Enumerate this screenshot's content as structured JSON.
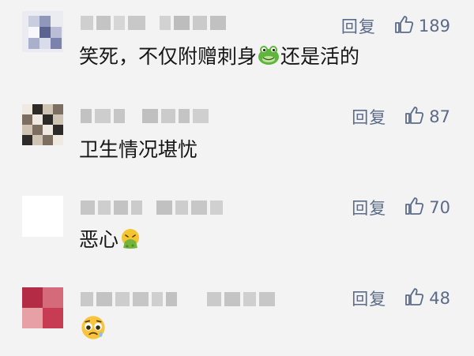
{
  "comments": [
    {
      "reply_label": "回复",
      "likes": "189",
      "text_before": "笑死，不仅附赠刺身",
      "emoji": "frog-face-emoji",
      "text_after": "还是活的",
      "avatar_colors": [
        "#d8dbe6",
        "#ffffff",
        "#9aa1bd",
        "#5b6391"
      ]
    },
    {
      "reply_label": "回复",
      "likes": "87",
      "text_before": "卫生情况堪忧",
      "emoji": "",
      "text_after": "",
      "avatar_colors": [
        "#2d2a27",
        "#cfc3b4",
        "#7d6e62",
        "#efe9e2"
      ]
    },
    {
      "reply_label": "回复",
      "likes": "70",
      "text_before": "恶心",
      "emoji": "vomiting-face-emoji",
      "text_after": "",
      "avatar_colors": [
        "#ffffff",
        "#ffffff",
        "#ffffff",
        "#ffffff"
      ]
    },
    {
      "reply_label": "回复",
      "likes": "48",
      "text_before": "",
      "emoji": "pleading-sweat-face-emoji",
      "text_after": "",
      "avatar_colors": [
        "#c73c52",
        "#d9868f",
        "#b32b44",
        "#e7a1a6"
      ]
    }
  ],
  "colors": {
    "meta": "#5b6b88",
    "text": "#161616",
    "background": "#f3f3f3",
    "blur_block": "#cbcbcb"
  }
}
